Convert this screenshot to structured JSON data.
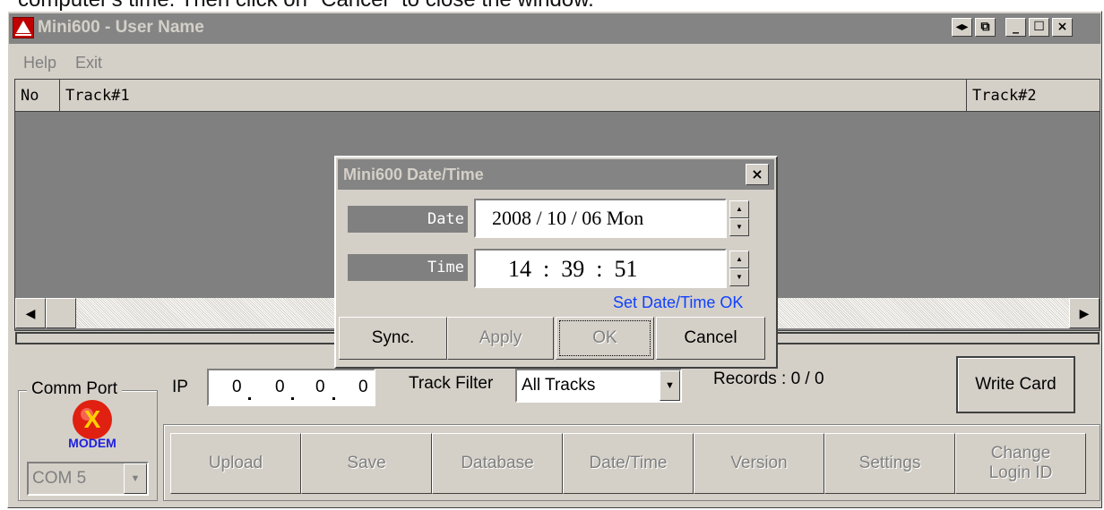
{
  "caption": "computer's time. Then click on \"Cancel\" to close the window.",
  "window": {
    "title": "Mini600  -  User Name",
    "controls": {
      "tile": "◂▸",
      "restore": "⧉",
      "minimize": "_",
      "maximize": "☐",
      "close": "×"
    }
  },
  "menu": {
    "help": "Help",
    "exit": "Exit"
  },
  "grid": {
    "columns": [
      "No",
      "Track#1",
      "Track#2"
    ]
  },
  "comm_port": {
    "label": "Comm Port",
    "modem_icon_text": "MODEM",
    "port_value": "COM 5"
  },
  "ip": {
    "label": "IP",
    "octets": [
      "0",
      "0",
      "0",
      "0"
    ]
  },
  "track_filter": {
    "label": "Track Filter",
    "value": "All Tracks"
  },
  "records": {
    "text": "Records : 0 / 0"
  },
  "write_card": "Write Card",
  "actions": [
    "Upload",
    "Save",
    "Database",
    "Date/Time",
    "Version",
    "Settings",
    "Change\nLogin ID"
  ],
  "dialog": {
    "title": "Mini600 Date/Time",
    "date_label": "Date",
    "date_value": "2008 / 10 / 06  Mon",
    "time_label": "Time",
    "time_value": "14  :  39  :  51",
    "status": "Set Date/Time OK",
    "buttons": {
      "sync": "Sync.",
      "apply": "Apply",
      "ok": "OK",
      "cancel": "Cancel"
    }
  },
  "colors": {
    "title_bar": "#848484",
    "face": "#d4d0c8",
    "status_blue": "#1040ff"
  }
}
